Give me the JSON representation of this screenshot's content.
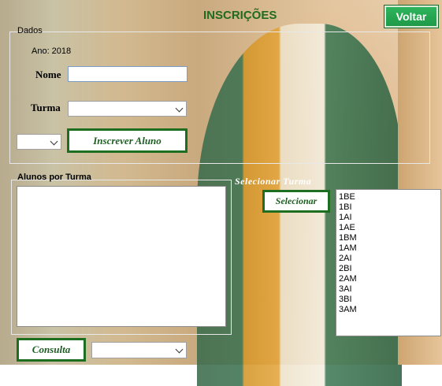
{
  "window": {
    "title": "INSCRIÇÕES",
    "back_label": "Voltar"
  },
  "dados": {
    "group_label": "Dados",
    "ano_label": "Ano: 2018",
    "nome_label": "Nome",
    "nome_value": "",
    "turma_label": "Turma",
    "turma_value": "",
    "small_select_value": "",
    "inscrever_label": "Inscrever Aluno"
  },
  "alunos": {
    "group_label": "Alunos por Turma",
    "consulta_label": "Consulta",
    "consulta_select_value": ""
  },
  "selecionar": {
    "heading": "Selecionar Turma",
    "button_label": "Selecionar",
    "turmas": [
      "1BE",
      "1BI",
      "1AI",
      "1AE",
      "1BM",
      "1AM",
      "2AI",
      "2BI",
      "2AM",
      "3AI",
      "3BI",
      "3AM"
    ]
  }
}
